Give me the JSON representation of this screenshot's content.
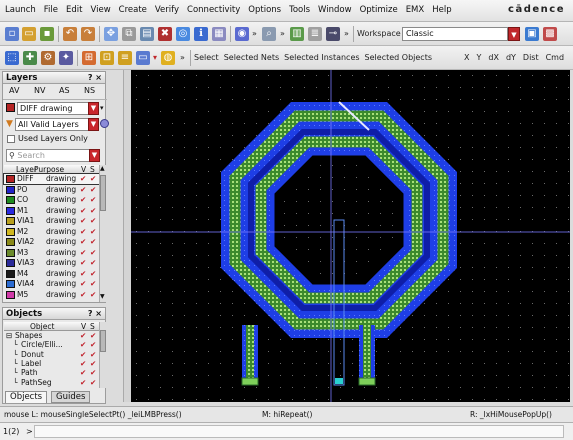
{
  "menus": [
    "Launch",
    "File",
    "Edit",
    "View",
    "Create",
    "Verify",
    "Connectivity",
    "Options",
    "Tools",
    "Window",
    "Optimize",
    "EMX",
    "Help"
  ],
  "brand": "cādence",
  "toolbar": {
    "workspace_label": "Workspace",
    "workspace_value": "Classic",
    "select_labels": [
      "Select",
      "Selected Nets",
      "Selected Instances",
      "Selected Objects"
    ],
    "coord_labels": [
      "X",
      "Y",
      "dX",
      "dY",
      "Dist",
      "Cmd"
    ]
  },
  "layers_panel": {
    "title": "Layers",
    "controls": "? ×",
    "tabs": [
      "AV",
      "NV",
      "AS",
      "NS"
    ],
    "current_layer": "DIFF drawing",
    "filter": "All Valid Layers",
    "used_only_label": "Used Layers Only",
    "search_placeholder": "Search",
    "columns": [
      "Layer",
      "Purpose",
      "V",
      "S"
    ],
    "rows": [
      {
        "layer": "DIFF",
        "purpose": "drawing",
        "color": "#b52424",
        "selected": true
      },
      {
        "layer": "PO",
        "purpose": "drawing",
        "color": "#2323c8"
      },
      {
        "layer": "CO",
        "purpose": "drawing",
        "color": "#1f8a1f"
      },
      {
        "layer": "M1",
        "purpose": "drawing",
        "color": "#2a2ae0"
      },
      {
        "layer": "VIA1",
        "purpose": "drawing",
        "color": "#b8a01e"
      },
      {
        "layer": "M2",
        "purpose": "drawing",
        "color": "#d0b820"
      },
      {
        "layer": "VIA2",
        "purpose": "drawing",
        "color": "#8a8a1a"
      },
      {
        "layer": "M3",
        "purpose": "drawing",
        "color": "#6a8a2a"
      },
      {
        "layer": "VIA3",
        "purpose": "drawing",
        "color": "#2a2a9a"
      },
      {
        "layer": "M4",
        "purpose": "drawing",
        "color": "#1a1a1a"
      },
      {
        "layer": "VIA4",
        "purpose": "drawing",
        "color": "#2a6ad0"
      },
      {
        "layer": "M5",
        "purpose": "drawing",
        "color": "#d03aa8"
      }
    ]
  },
  "objects_panel": {
    "title": "Objects",
    "controls": "? ×",
    "columns": [
      "Object",
      "V",
      "S"
    ],
    "rows": [
      "Shapes",
      "Circle/Elli...",
      "Donut",
      "Label",
      "Path",
      "PathSeg"
    ],
    "tabs": [
      "Objects",
      "Guides"
    ]
  },
  "status": {
    "left": "mouse L: mouseSingleSelectPt() _leiLMBPress()",
    "mid": "M: hiRepeat()",
    "right": "R: _lxHiMousePopUp()"
  },
  "command": {
    "prompt": "1(2)",
    "cursor": ">"
  },
  "colors": {
    "canvas": "#000000",
    "metal_top": "#1e3ee6",
    "metal_bottom": "#0f1ea8",
    "mesh": "#7ecf5a",
    "accent_red": "#c9262c"
  }
}
